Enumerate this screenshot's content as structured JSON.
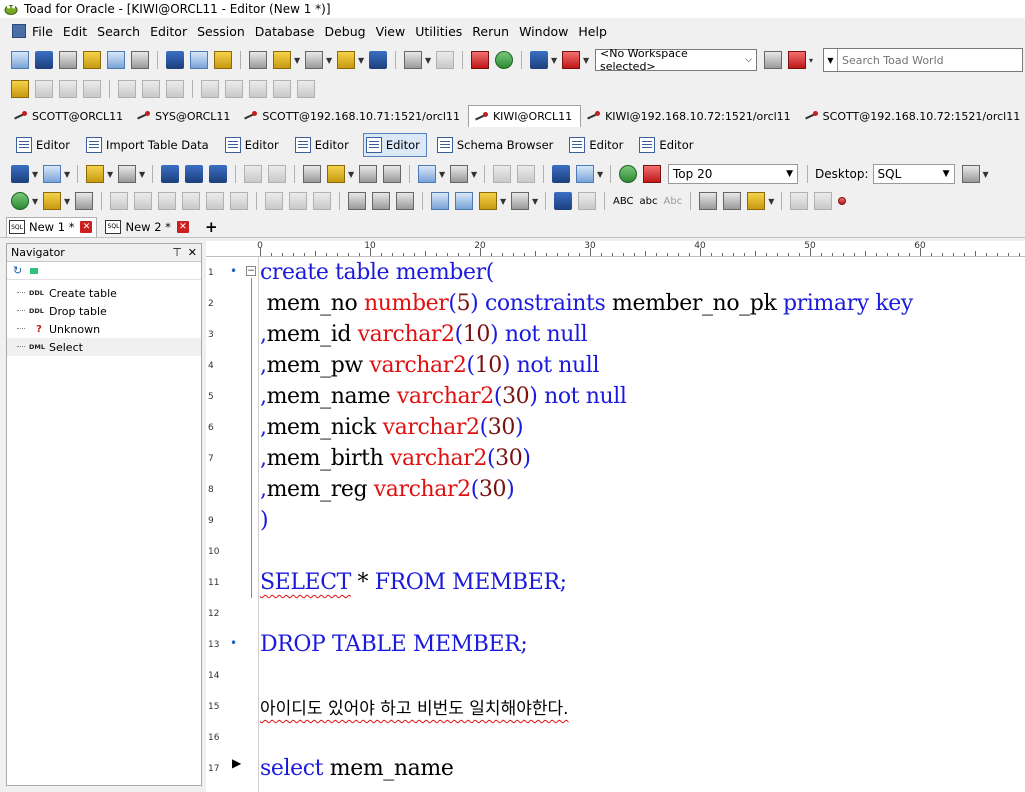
{
  "window": {
    "title": "Toad for Oracle - [KIWI@ORCL11 - Editor (New 1 *)]"
  },
  "menu": {
    "items": [
      "File",
      "Edit",
      "Search",
      "Editor",
      "Session",
      "Database",
      "Debug",
      "View",
      "Utilities",
      "Rerun",
      "Window",
      "Help"
    ]
  },
  "toolbar": {
    "workspace": "<No Workspace selected>",
    "search_placeholder": "Search Toad World"
  },
  "connections": [
    "SCOTT@ORCL11",
    "SYS@ORCL11",
    "SCOTT@192.168.10.71:1521/orcl11",
    "KIWI@ORCL11",
    "KIWI@192.168.10.72:1521/orcl11",
    "SCOTT@192.168.10.72:1521/orcl11"
  ],
  "windows": [
    "Editor",
    "Import Table Data",
    "Editor",
    "Editor",
    "Editor",
    "Schema Browser",
    "Editor",
    "Editor"
  ],
  "editor_toolbar": {
    "top": "Top 20",
    "desktop_label": "Desktop:",
    "desktop_value": "SQL",
    "abc1": "ABC",
    "abc2": "abc",
    "abc3": "Abc"
  },
  "editor_tabs": [
    {
      "label": "New 1 *"
    },
    {
      "label": "New 2 *"
    }
  ],
  "navigator": {
    "title": "Navigator",
    "items": [
      {
        "kind": "DDL",
        "label": "Create table"
      },
      {
        "kind": "DDL",
        "label": "Drop table"
      },
      {
        "kind": "?",
        "label": "Unknown"
      },
      {
        "kind": "DML",
        "label": "Select"
      }
    ]
  },
  "ruler": {
    "labels": [
      "0",
      "10",
      "20",
      "30",
      "40",
      "50",
      "60"
    ]
  },
  "code_lines": [
    {
      "n": "1",
      "t": "create table member("
    },
    {
      "n": "2",
      "t": " mem_no number(5) constraints member_no_pk primary key"
    },
    {
      "n": "3",
      "t": ",mem_id varchar2(10) not null"
    },
    {
      "n": "4",
      "t": ",mem_pw varchar2(10) not null"
    },
    {
      "n": "5",
      "t": ",mem_name varchar2(30) not null"
    },
    {
      "n": "6",
      "t": ",mem_nick varchar2(30)"
    },
    {
      "n": "7",
      "t": ",mem_birth varchar2(30)"
    },
    {
      "n": "8",
      "t": ",mem_reg varchar2(30)"
    },
    {
      "n": "9",
      "t": ")"
    },
    {
      "n": "10",
      "t": ""
    },
    {
      "n": "11",
      "t": "SELECT * FROM MEMBER;"
    },
    {
      "n": "12",
      "t": ""
    },
    {
      "n": "13",
      "t": "DROP TABLE MEMBER;"
    },
    {
      "n": "14",
      "t": ""
    },
    {
      "n": "15",
      "t": "아이디도 있어야 하고 비번도 일치해야한다."
    },
    {
      "n": "16",
      "t": ""
    },
    {
      "n": "17",
      "t": "select mem_name"
    }
  ],
  "colors": {
    "keyword": "#1a1adc",
    "type": "#e01010",
    "number": "#7a1010",
    "text": "#000000",
    "selection_tab": "#dbe8f6"
  }
}
